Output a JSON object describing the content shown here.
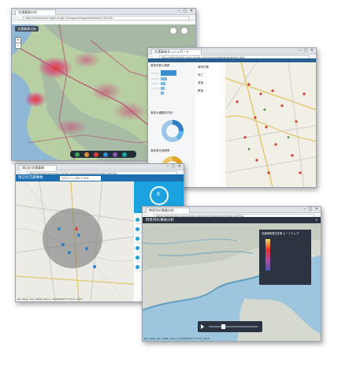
{
  "windows": {
    "heatmap": {
      "tab_title": "交通事故分析",
      "url": "https://tsubakimoto.maps.arcgis.com/apps/webappviewer/index.html?id=",
      "app_title": "交通事故分析",
      "icons": [
        "layers-icon",
        "legend-icon",
        "basemap-icon",
        "print-icon",
        "share-icon",
        "search-icon"
      ]
    },
    "dashboard": {
      "tab_title": "交通事故ダッシュボード",
      "url": "https://tsubakimoto.maps.arcgis.com/apps/opsdashboard/index.html",
      "panel_titles": [
        "事故件数の推移",
        "事故の種類別内訳",
        "事故発生時間帯"
      ],
      "list_items": [
        "事故件数",
        "死亡",
        "重傷",
        "軽傷"
      ]
    },
    "buffer": {
      "tab_title": "周辺の交通事故",
      "url": "https://tsubakimoto.maps.arcgis.com/apps/webappviewer/index.html?id=",
      "app_title": "周辺の交通事故",
      "search_placeholder": "住所または場所を検索",
      "side_count": "8",
      "attribution": "Esri Japan, Esri, HERE, Garmin, INCREMENT P, NGA, USGS"
    },
    "timeline": {
      "tab_title": "時系列の事故分析",
      "url": "https://tsubakimoto.maps.arcgis.com/apps/webappviewer/index.html?id=",
      "app_title": "時系列の事故分析",
      "legend_title": "交通事故発生件数 ヒートマップ",
      "attribution": "Esri Japan, Esri, HERE, Garmin, INCREMENT P, NGA, USGS"
    }
  },
  "colors": {
    "app_bar_dark": "#3c4a5a",
    "app_bar_blue": "#1d6fb0",
    "heat_pink": "#d9457a",
    "heat_red": "#e8312a",
    "water_blue": "#9ec5de",
    "land_green": "#8fb26a"
  }
}
